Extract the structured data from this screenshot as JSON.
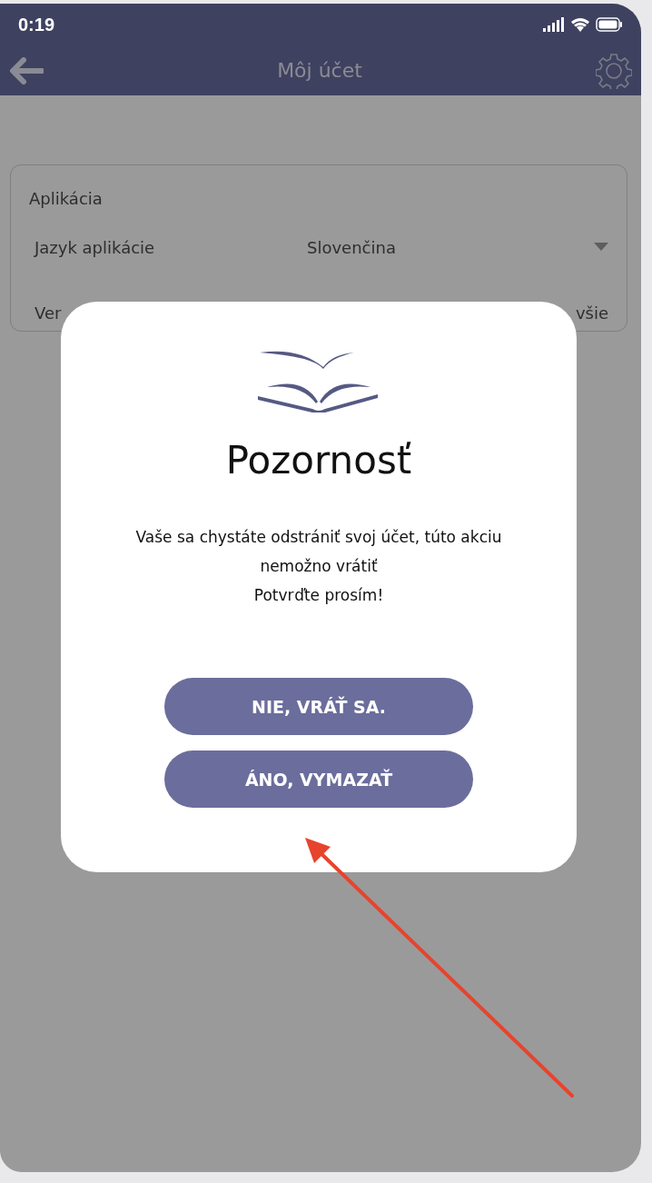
{
  "status_bar": {
    "time": "0:19"
  },
  "nav_bar": {
    "title": "Môj účet"
  },
  "section": {
    "title": "Aplikácia",
    "rows": [
      {
        "kind": "dropdown",
        "label": "Jazyk aplikácie",
        "value": "Slovenčina"
      },
      {
        "kind": "text",
        "label": "Ver",
        "value": "všie"
      }
    ]
  },
  "dialog": {
    "title": "Pozornosť",
    "message_lines": [
      "Vaše sa chystáte odstrániť svoj účet, túto akciu",
      "nemožno vrátiť",
      "Potvrďte prosím!"
    ],
    "buttons": [
      "NIE, VRÁŤ SA.",
      "ÁNO, VYMAZAŤ"
    ]
  }
}
